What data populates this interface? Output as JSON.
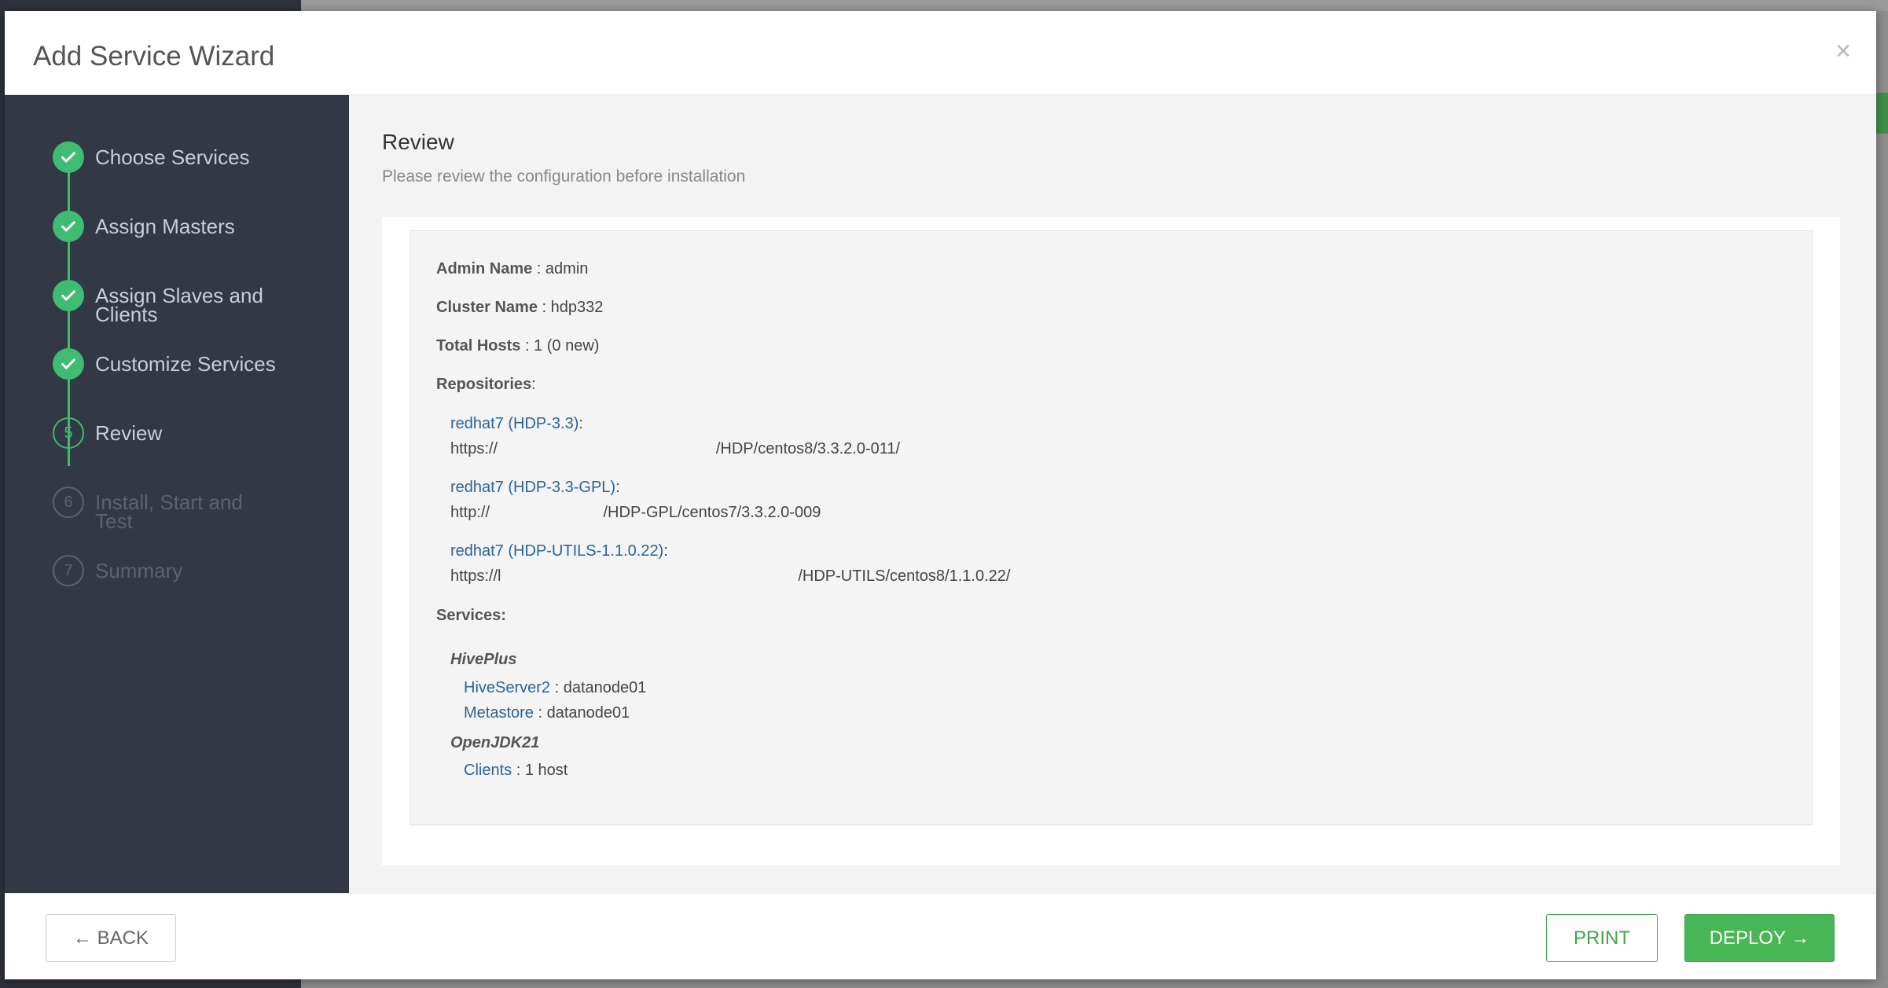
{
  "modal": {
    "title": "Add Service Wizard",
    "close": "×"
  },
  "steps": [
    {
      "label": "Choose Services",
      "state": "done",
      "number": "1"
    },
    {
      "label": "Assign Masters",
      "state": "done",
      "number": "2"
    },
    {
      "label": "Assign Slaves and Clients",
      "state": "done",
      "number": "3"
    },
    {
      "label": "Customize Services",
      "state": "done",
      "number": "4"
    },
    {
      "label": "Review",
      "state": "current",
      "number": "5"
    },
    {
      "label": "Install, Start and Test",
      "state": "future",
      "number": "6"
    },
    {
      "label": "Summary",
      "state": "future",
      "number": "7"
    }
  ],
  "review": {
    "title": "Review",
    "subtitle": "Please review the configuration before installation",
    "admin_label": "Admin Name",
    "admin_value": "admin",
    "cluster_label": "Cluster Name",
    "cluster_value": "hdp332",
    "hosts_label": "Total Hosts",
    "hosts_value": "1 (0 new)",
    "repos_label": "Repositories",
    "repos": [
      {
        "name": "redhat7 (HDP-3.3)",
        "url": "https://                                                  /HDP/centos8/3.3.2.0-011/"
      },
      {
        "name": "redhat7 (HDP-3.3-GPL)",
        "url": "http://                          /HDP-GPL/centos7/3.3.2.0-009"
      },
      {
        "name": "redhat7 (HDP-UTILS-1.1.0.22)",
        "url": "https://l                                                                    /HDP-UTILS/centos8/1.1.0.22/"
      }
    ],
    "services_label": "Services:",
    "services": [
      {
        "name": "HivePlus",
        "components": [
          {
            "name": "HiveServer2",
            "value": "datanode01"
          },
          {
            "name": "Metastore",
            "value": "datanode01"
          }
        ]
      },
      {
        "name": "OpenJDK21",
        "components": [
          {
            "name": "Clients",
            "value": "1 host"
          }
        ]
      }
    ]
  },
  "footer": {
    "back_label": "← BACK",
    "print_label": "PRINT",
    "deploy_label": "DEPLOY →"
  },
  "colors": {
    "accent": "#3fbb72",
    "sidebar": "#323844",
    "link": "#2a6496",
    "deploy": "#48b556"
  }
}
